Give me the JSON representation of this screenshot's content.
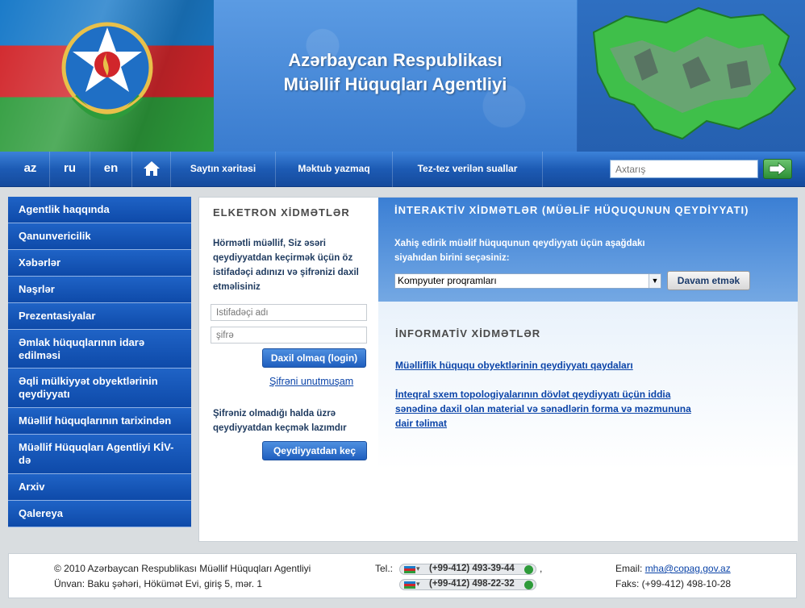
{
  "header": {
    "title_line1": "Azərbaycan Respublikası",
    "title_line2": "Müəllif Hüquqları Agentliyi"
  },
  "nav": {
    "lang_az": "az",
    "lang_ru": "ru",
    "lang_en": "en",
    "sitemap": "Saytın xəritəsi",
    "write_letter": "Məktub yazmaq",
    "faq": "Tez-tez verilən suallar",
    "search_placeholder": "Axtarış"
  },
  "sidebar": {
    "items": [
      {
        "label": "Agentlik haqqında"
      },
      {
        "label": "Qanunvericilik"
      },
      {
        "label": "Xəbərlər"
      },
      {
        "label": "Nəşrlər"
      },
      {
        "label": "Prezentasiyalar"
      },
      {
        "label": "Əmlak hüquqlarının idarə edilməsi"
      },
      {
        "label": "Əqli mülkiyyət obyektlərinin qeydiyyatı"
      },
      {
        "label": "Müəllif hüquqlarının tarixindən"
      },
      {
        "label": "Müəllif Hüquqları Agentliyi KİV-də"
      },
      {
        "label": "Arxiv"
      },
      {
        "label": "Qalereya"
      }
    ]
  },
  "login": {
    "title": "ELKETRON XİDMƏTLƏR",
    "intro": "Hörmətli müəllif, Siz əsəri qeydiyyatdan keçirmək üçün öz istifadəçi adınızı və şifrənizi daxil etməlisiniz",
    "username_placeholder": "İstifadəçi adı",
    "password_placeholder": "şifrə",
    "login_button": "Daxil olmaq (login)",
    "forgot_link": "Şifrəni unutmuşam",
    "register_text": "Şifrəniz olmadığı halda üzrə qeydiyyatdan keçmək lazımdır",
    "register_button": "Qeydiyyatdan keç"
  },
  "interactive": {
    "title": "İNTERAKTİV XİDMƏTLƏR (MÜƏLİF HÜQUQUNUN QEYDİYYATI)",
    "instruction": "Xahiş edirik müəlif hüququnun qeydiyyatı üçün aşağdakı siyahıdan birini seçəsiniz:",
    "selected_option": "Kompyuter proqramları",
    "continue_button": "Davam etmək"
  },
  "informative": {
    "title": "İNFORMATİV XİDMƏTLƏR",
    "link1": "Müəlliflik hüququ obyektlərinin qeydiyyatı qaydaları",
    "link2": "İnteqral sxem topologiyalarının dövlət qeydiyyatı üçün iddia sənədinə daxil olan material və sənədlərin forma və məzmununa dair təlimat"
  },
  "footer": {
    "copyright": "© 2010 Azərbaycan Respublikası Müəllif Hüquqları Agentliyi",
    "address": "Ünvan: Baku şəhəri, Hökümət Evi, giriş 5, mər. 1",
    "tel_label": "Tel.:",
    "phone1": "(+99-412) 493-39-44",
    "phone2": "(+99-412) 498-22-32",
    "email_label": "Email:",
    "email": "mha@copag.gov.az",
    "fax": "Faks: (+99-412) 498-10-28"
  },
  "colors": {
    "primary_blue": "#1f63c6",
    "nav_blue": "#1d5bb4",
    "link_blue": "#0b44a8",
    "go_green": "#2b8f35"
  }
}
